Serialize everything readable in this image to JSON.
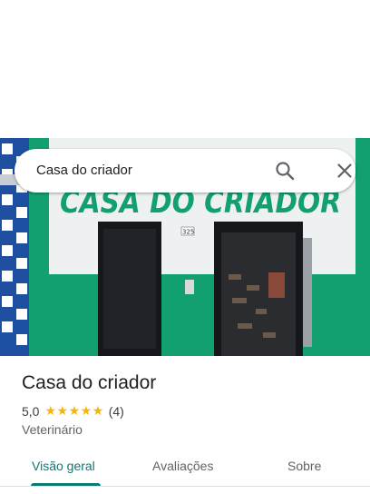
{
  "search": {
    "query": "Casa do criador"
  },
  "place": {
    "name": "Casa do criador",
    "rating": "5,0",
    "stars": "★★★★★",
    "review_count": "(4)",
    "category": "Veterinário"
  },
  "photo": {
    "sign_text": "CASA DO CRIADOR",
    "door_number": "325"
  },
  "tabs": [
    {
      "label": "Visão geral",
      "active": true
    },
    {
      "label": "Avaliações",
      "active": false
    },
    {
      "label": "Sobre",
      "active": false
    }
  ],
  "colors": {
    "accent": "#0b7a75",
    "star": "#f5b50a",
    "storefront_green": "#12a070"
  }
}
